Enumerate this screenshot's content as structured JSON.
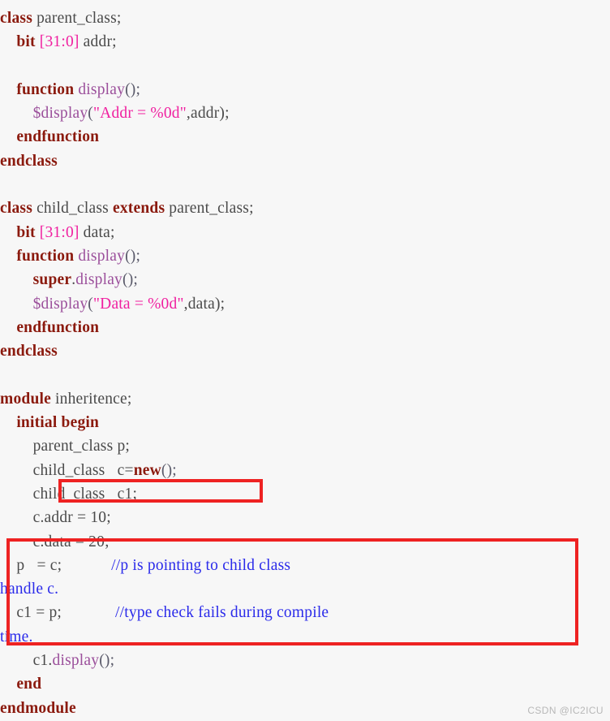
{
  "page": {
    "background_color": "#f7f7f7",
    "watermark": "CSDN @IC2ICU"
  },
  "colors": {
    "keyword": "#8b1a0e",
    "plain": "#4a4a4a",
    "string": "#f020a0",
    "bit_range": "#f020a0",
    "function_name": "#9b4f9b",
    "comment": "#2b2bea",
    "annotation_box": "#ee2222"
  },
  "code": {
    "language": "SystemVerilog",
    "lines": [
      {
        "id": "l1",
        "indent": 0,
        "tokens": [
          {
            "t": "class",
            "c": "kw"
          },
          {
            "t": " parent_class;",
            "c": "plain"
          }
        ]
      },
      {
        "id": "l2",
        "indent": 1,
        "tokens": [
          {
            "t": "bit",
            "c": "kw"
          },
          {
            "t": " ",
            "c": "plain"
          },
          {
            "t": "[31:0]",
            "c": "range"
          },
          {
            "t": " addr;",
            "c": "plain"
          }
        ]
      },
      {
        "id": "l3",
        "indent": 0,
        "tokens": []
      },
      {
        "id": "l4",
        "indent": 1,
        "tokens": [
          {
            "t": "function",
            "c": "kw"
          },
          {
            "t": " ",
            "c": "plain"
          },
          {
            "t": "display",
            "c": "fn"
          },
          {
            "t": "();",
            "c": "punct"
          }
        ]
      },
      {
        "id": "l5",
        "indent": 2,
        "tokens": [
          {
            "t": "$display",
            "c": "sys"
          },
          {
            "t": "(",
            "c": "punct"
          },
          {
            "t": "\"Addr = %0d\"",
            "c": "str"
          },
          {
            "t": ",addr);",
            "c": "plain"
          }
        ]
      },
      {
        "id": "l6",
        "indent": 1,
        "tokens": [
          {
            "t": "endfunction",
            "c": "kw"
          }
        ]
      },
      {
        "id": "l7",
        "indent": 0,
        "tokens": [
          {
            "t": "endclass",
            "c": "kw"
          }
        ]
      },
      {
        "id": "l8",
        "indent": 0,
        "tokens": []
      },
      {
        "id": "l9",
        "indent": 0,
        "tokens": [
          {
            "t": "class",
            "c": "kw"
          },
          {
            "t": " child_class ",
            "c": "plain"
          },
          {
            "t": "extends",
            "c": "kw"
          },
          {
            "t": " parent_class;",
            "c": "plain"
          }
        ]
      },
      {
        "id": "l10",
        "indent": 1,
        "tokens": [
          {
            "t": "bit",
            "c": "kw"
          },
          {
            "t": " ",
            "c": "plain"
          },
          {
            "t": "[31:0]",
            "c": "range"
          },
          {
            "t": " data;",
            "c": "plain"
          }
        ]
      },
      {
        "id": "l11",
        "indent": 1,
        "tokens": [
          {
            "t": "function",
            "c": "kw"
          },
          {
            "t": " ",
            "c": "plain"
          },
          {
            "t": "display",
            "c": "fn"
          },
          {
            "t": "();",
            "c": "punct"
          }
        ]
      },
      {
        "id": "l12",
        "indent": 2,
        "tokens": [
          {
            "t": "super",
            "c": "kw"
          },
          {
            "t": ".",
            "c": "plain"
          },
          {
            "t": "display",
            "c": "fn"
          },
          {
            "t": "();",
            "c": "punct"
          }
        ]
      },
      {
        "id": "l13",
        "indent": 2,
        "tokens": [
          {
            "t": "$display",
            "c": "sys"
          },
          {
            "t": "(",
            "c": "punct"
          },
          {
            "t": "\"Data = %0d\"",
            "c": "str"
          },
          {
            "t": ",data);",
            "c": "plain"
          }
        ]
      },
      {
        "id": "l14",
        "indent": 1,
        "tokens": [
          {
            "t": "endfunction",
            "c": "kw"
          }
        ]
      },
      {
        "id": "l15",
        "indent": 0,
        "tokens": [
          {
            "t": "endclass",
            "c": "kw"
          }
        ]
      },
      {
        "id": "l16",
        "indent": 0,
        "tokens": []
      },
      {
        "id": "l17",
        "indent": 0,
        "tokens": [
          {
            "t": "module",
            "c": "kw"
          },
          {
            "t": " inheritence;",
            "c": "plain"
          }
        ]
      },
      {
        "id": "l18",
        "indent": 1,
        "tokens": [
          {
            "t": "initial begin",
            "c": "kw"
          }
        ]
      },
      {
        "id": "l19",
        "indent": 2,
        "tokens": [
          {
            "t": "parent_class p;",
            "c": "plain"
          }
        ]
      },
      {
        "id": "l20",
        "indent": 2,
        "tokens": [
          {
            "t": "child_class   c=",
            "c": "plain"
          },
          {
            "t": "new",
            "c": "kw"
          },
          {
            "t": "();",
            "c": "punct"
          }
        ]
      },
      {
        "id": "l21",
        "indent": 2,
        "tokens": [
          {
            "t": "child_class   c1;",
            "c": "plain"
          }
        ],
        "boxed": "box-small"
      },
      {
        "id": "l22",
        "indent": 2,
        "tokens": [
          {
            "t": "c.addr = 10;",
            "c": "plain"
          }
        ]
      },
      {
        "id": "l23",
        "indent": 2,
        "tokens": [
          {
            "t": "c.data = 20;",
            "c": "plain"
          }
        ]
      },
      {
        "id": "l24",
        "indent": 1,
        "tokens": [
          {
            "t": "p   = c;            ",
            "c": "plain"
          },
          {
            "t": "//p is pointing to child class",
            "c": "cmt"
          }
        ]
      },
      {
        "id": "l25",
        "indent": -1,
        "tokens": [
          {
            "t": "handle c.",
            "c": "cmt"
          }
        ]
      },
      {
        "id": "l26",
        "indent": 1,
        "tokens": [
          {
            "t": "c1 = p;             ",
            "c": "plain"
          },
          {
            "t": "//type check fails during compile",
            "c": "cmt"
          }
        ]
      },
      {
        "id": "l27",
        "indent": -1,
        "tokens": [
          {
            "t": "time.",
            "c": "cmt"
          }
        ]
      },
      {
        "id": "l28",
        "indent": 2,
        "tokens": [
          {
            "t": "c1.",
            "c": "plain"
          },
          {
            "t": "display",
            "c": "fn"
          },
          {
            "t": "();",
            "c": "punct"
          }
        ]
      },
      {
        "id": "l29",
        "indent": 1,
        "tokens": [
          {
            "t": "end",
            "c": "kw"
          }
        ]
      },
      {
        "id": "l30",
        "indent": 0,
        "tokens": [
          {
            "t": "endmodule",
            "c": "kw"
          }
        ]
      }
    ]
  },
  "annotations": {
    "boxes": [
      {
        "id": "box-small",
        "label": "child_class c1 declaration highlight"
      },
      {
        "id": "box-large",
        "label": "pointer assignment and type check comments highlight"
      }
    ]
  }
}
